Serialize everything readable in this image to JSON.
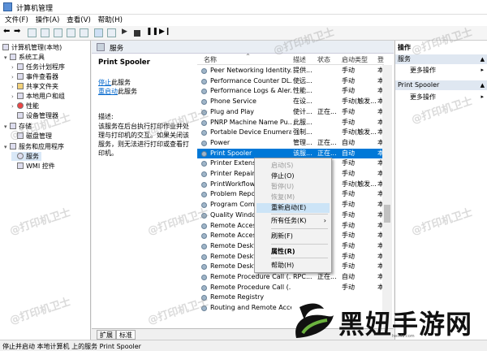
{
  "window": {
    "title": "计算机管理"
  },
  "menu": [
    "文件(F)",
    "操作(A)",
    "查看(V)",
    "帮助(H)"
  ],
  "tree": {
    "root": "计算机管理(本地)",
    "items": [
      {
        "label": "系统工具",
        "level": 1
      },
      {
        "label": "任务计划程序",
        "level": 2
      },
      {
        "label": "事件查看器",
        "level": 2
      },
      {
        "label": "共享文件夹",
        "level": 2
      },
      {
        "label": "本地用户和组",
        "level": 2
      },
      {
        "label": "性能",
        "level": 2
      },
      {
        "label": "设备管理器",
        "level": 2
      },
      {
        "label": "存储",
        "level": 1
      },
      {
        "label": "磁盘管理",
        "level": 2
      },
      {
        "label": "服务和应用程序",
        "level": 1
      },
      {
        "label": "服务",
        "level": 2
      },
      {
        "label": "WMI 控件",
        "level": 2
      }
    ]
  },
  "panel": {
    "title": "服务"
  },
  "description": {
    "service_name": "Print Spooler",
    "stop_link": "停止",
    "stop_suffix": "此服务",
    "restart_link": "重启动",
    "restart_suffix": "此服务",
    "desc_label": "描述:",
    "desc_text": "该服务在后台执行打印作业并处理与打印机的交互。如果关闭该服务，则无法进行打印或查看打印机。"
  },
  "columns": [
    "名称",
    "描述",
    "状态",
    "启动类型",
    "登"
  ],
  "services": [
    {
      "name": "Peer Networking Identity...",
      "desc": "提供...",
      "status": "",
      "startup": "手动",
      "logon": "本"
    },
    {
      "name": "Performance Counter DL...",
      "desc": "使远...",
      "status": "",
      "startup": "手动",
      "logon": "本"
    },
    {
      "name": "Performance Logs & Aler...",
      "desc": "性能...",
      "status": "",
      "startup": "手动",
      "logon": "本"
    },
    {
      "name": "Phone Service",
      "desc": "在设...",
      "status": "",
      "startup": "手动(触发...",
      "logon": "本"
    },
    {
      "name": "Plug and Play",
      "desc": "使计...",
      "status": "正在...",
      "startup": "手动",
      "logon": "本"
    },
    {
      "name": "PNRP Machine Name Pu...",
      "desc": "此服...",
      "status": "",
      "startup": "手动",
      "logon": "本"
    },
    {
      "name": "Portable Device Enumera...",
      "desc": "强制...",
      "status": "",
      "startup": "手动(触发...",
      "logon": "本"
    },
    {
      "name": "Power",
      "desc": "管理...",
      "status": "正在...",
      "startup": "自动",
      "logon": "本"
    },
    {
      "name": "Print Spooler",
      "desc": "该服...",
      "status": "正在...",
      "startup": "自动",
      "logon": "本"
    },
    {
      "name": "Printer Extensio...",
      "desc": "",
      "status": "",
      "startup": "手动",
      "logon": "本"
    },
    {
      "name": "Printer Repair ...",
      "desc": "",
      "status": "",
      "startup": "手动",
      "logon": "本"
    },
    {
      "name": "PrintWorkflow_...",
      "desc": "",
      "status": "",
      "startup": "手动(触发...",
      "logon": "本"
    },
    {
      "name": "Problem Repor...",
      "desc": "",
      "status": "",
      "startup": "手动",
      "logon": "本"
    },
    {
      "name": "Program Comp...",
      "desc": "",
      "status": "",
      "startup": "手动",
      "logon": "本"
    },
    {
      "name": "Quality Window...",
      "desc": "",
      "status": "",
      "startup": "手动",
      "logon": "本"
    },
    {
      "name": "Remote Access...",
      "desc": "",
      "status": "",
      "startup": "手动",
      "logon": "本"
    },
    {
      "name": "Remote Access...",
      "desc": "",
      "status": "",
      "startup": "手动",
      "logon": "本"
    },
    {
      "name": "Remote Deskto...",
      "desc": "",
      "status": "",
      "startup": "手动",
      "logon": "本"
    },
    {
      "name": "Remote Deskto...",
      "desc": "",
      "status": "",
      "startup": "手动",
      "logon": "本"
    },
    {
      "name": "Remote Deskto...",
      "desc": "",
      "status": "",
      "startup": "手动",
      "logon": "本"
    },
    {
      "name": "Remote Procedure Call (...",
      "desc": "RPC...",
      "status": "正在...",
      "startup": "自动",
      "logon": "本"
    },
    {
      "name": "Remote Procedure Call (...",
      "desc": "",
      "status": "",
      "startup": "手动",
      "logon": "本"
    },
    {
      "name": "Remote Registry",
      "desc": "",
      "status": "",
      "startup": "",
      "logon": ""
    },
    {
      "name": "Routing and Remote Acce...",
      "desc": "",
      "status": "",
      "startup": "",
      "logon": ""
    }
  ],
  "context_menu": [
    {
      "label": "启动(S)",
      "disabled": true
    },
    {
      "label": "停止(O)",
      "disabled": false
    },
    {
      "label": "暂停(U)",
      "disabled": true
    },
    {
      "label": "恢复(M)",
      "disabled": true
    },
    {
      "label": "重新启动(E)",
      "disabled": false,
      "highlighted": true
    },
    {
      "label": "所有任务(K)",
      "disabled": false,
      "submenu": true
    },
    {
      "label": "刷新(F)",
      "disabled": false
    },
    {
      "label": "属性(R)",
      "disabled": false,
      "bold": true
    },
    {
      "label": "帮助(H)",
      "disabled": false
    }
  ],
  "tabs": [
    "扩展",
    "标准"
  ],
  "actions": {
    "header": "操作",
    "group1": "服务",
    "more1": "更多操作",
    "group2": "Print Spooler",
    "more2": "更多操作"
  },
  "statusbar": "停止并启动 本地计算机 上的服务 Print Spooler",
  "watermark": "@打印机卫士",
  "brand": {
    "name": "黑妞手游网",
    "sub": "heiniu.com"
  },
  "colors": {
    "selection": "#0078d7",
    "menu_highlight": "#cce4f7"
  }
}
